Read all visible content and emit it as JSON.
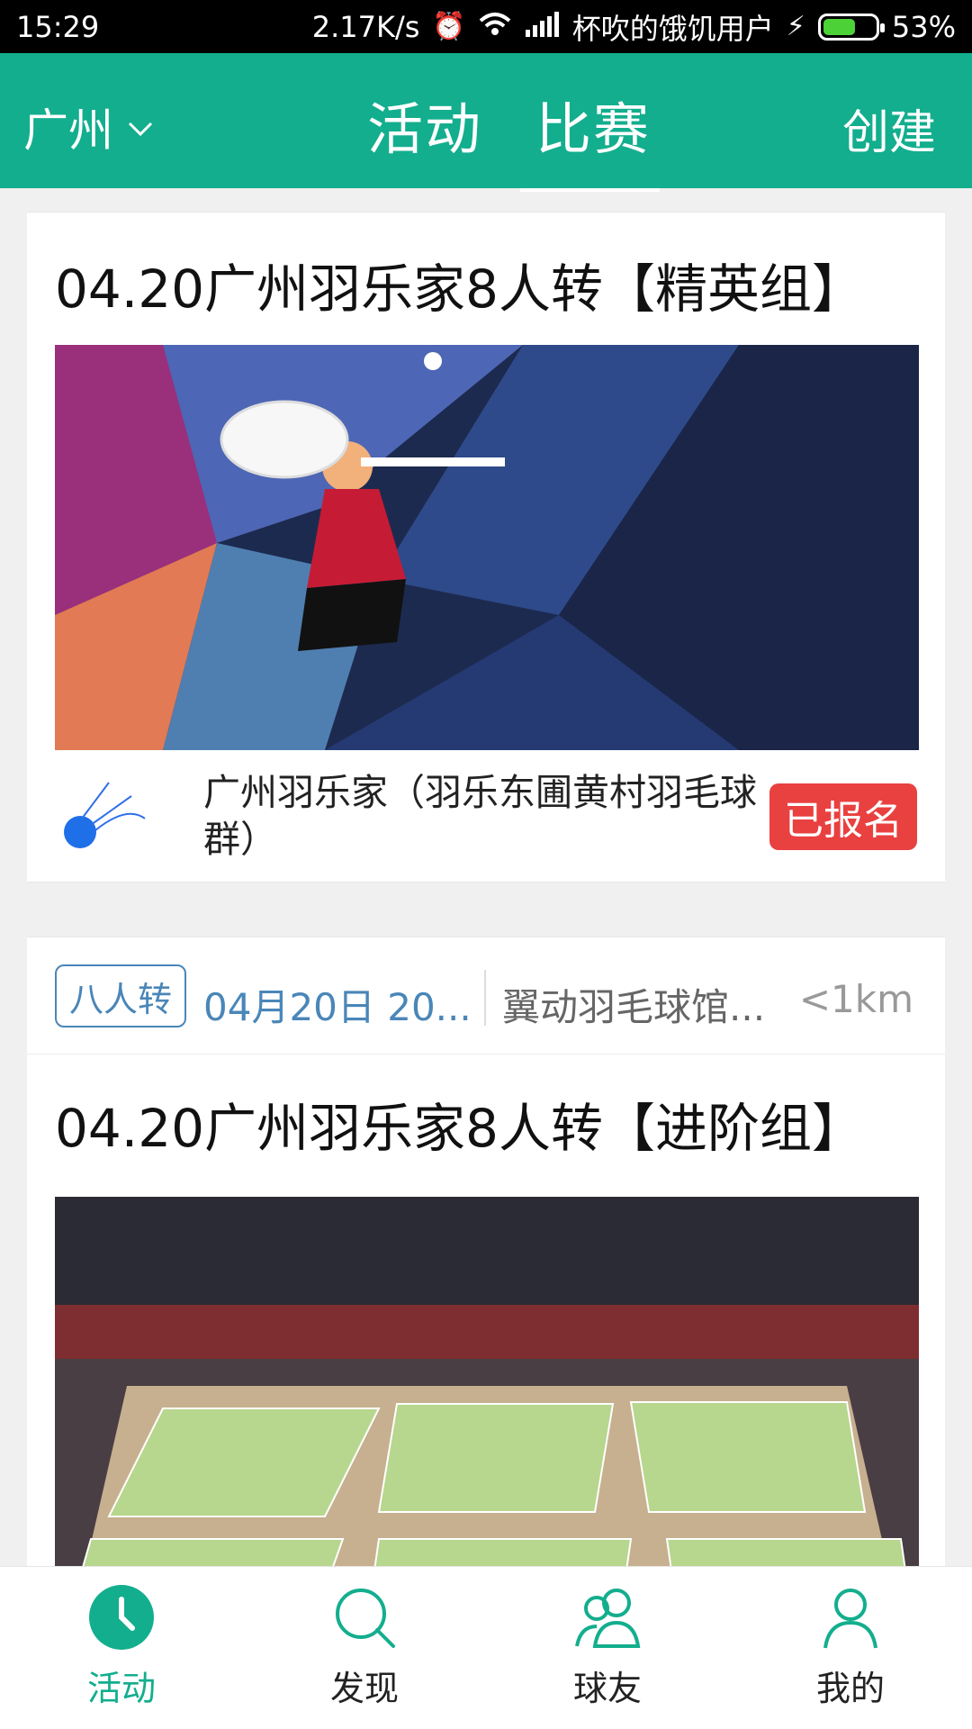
{
  "status_bar": {
    "time": "15:29",
    "network_speed": "2.17K/s",
    "carrier": "杯吹的饿饥用户",
    "battery": "53%",
    "icons": [
      "alarm-icon",
      "wifi-icon",
      "signal-icon",
      "charging-icon",
      "battery-icon"
    ]
  },
  "header": {
    "city": "广州",
    "tabs": [
      {
        "label": "活动",
        "active": false
      },
      {
        "label": "比赛",
        "active": true
      }
    ],
    "create_label": "创建",
    "accent_color": "#13ae8e"
  },
  "cards": [
    {
      "title": "04.20广州羽乐家8人转【精英组】",
      "organizer": "广州羽乐家（羽乐东圃黄村羽毛球群）",
      "status": "已报名",
      "status_color": "#e94040"
    },
    {
      "meta": {
        "tag": "八人转",
        "date": "04月20日 20...",
        "venue": "翼动羽毛球馆...",
        "distance": "<1km"
      },
      "title": "04.20广州羽乐家8人转【进阶组】"
    }
  ],
  "bottom_nav": [
    {
      "label": "活动",
      "icon": "clock-icon",
      "active": true
    },
    {
      "label": "发现",
      "icon": "search-icon",
      "active": false
    },
    {
      "label": "球友",
      "icon": "friends-icon",
      "active": false
    },
    {
      "label": "我的",
      "icon": "user-icon",
      "active": false
    }
  ]
}
